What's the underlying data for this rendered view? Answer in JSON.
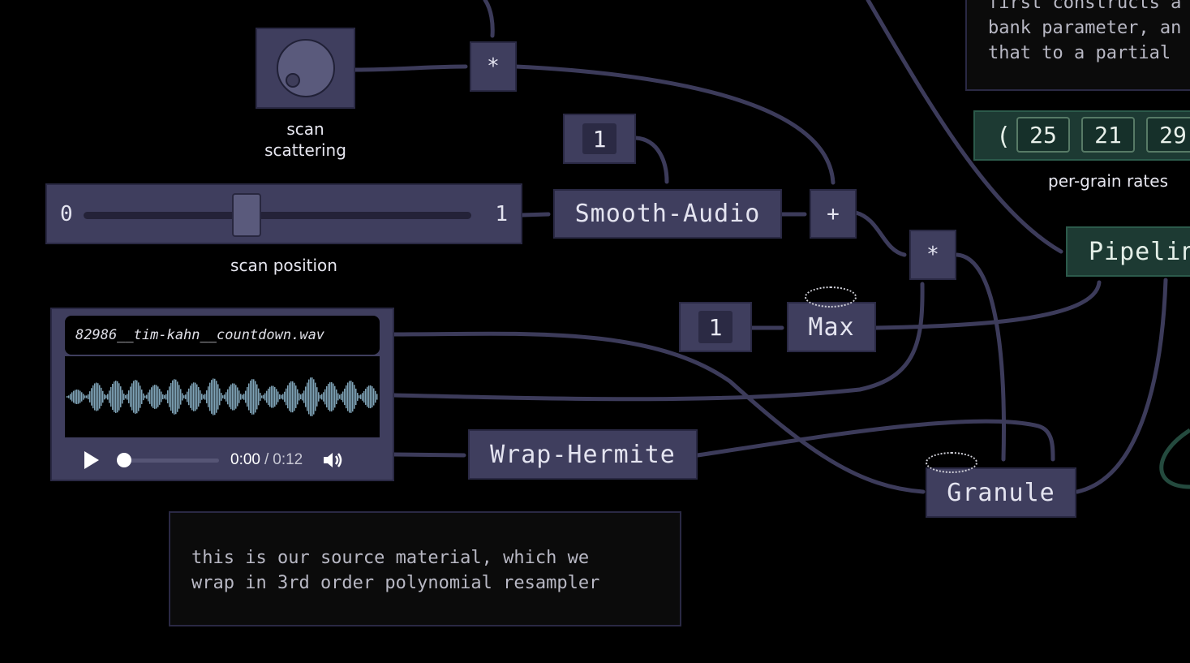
{
  "nodes": {
    "scan_scattering_knob": {
      "label": "scan\nscattering"
    },
    "multiply_top": {
      "symbol": "*"
    },
    "const_one_a": {
      "value": "1"
    },
    "smooth_audio": {
      "label": "Smooth-Audio"
    },
    "add": {
      "symbol": "+"
    },
    "multiply_mid": {
      "symbol": "*"
    },
    "scan_position_slider": {
      "min": "0",
      "max": "1",
      "value": 0.42,
      "label": "scan position"
    },
    "const_one_b": {
      "value": "1"
    },
    "max": {
      "label": "Max"
    },
    "wrap_hermite": {
      "label": "Wrap-Hermite"
    },
    "granule": {
      "label": "Granule"
    },
    "pipeline": {
      "label": "Pipelin"
    },
    "per_grain_rates": {
      "open_paren": "(",
      "values": [
        "25",
        "21",
        "29"
      ],
      "label": "per-grain rates"
    }
  },
  "audio_player": {
    "filename": "82986__tim-kahn__countdown.wav",
    "current_time": "0:00",
    "separator": "/",
    "duration": "0:12",
    "progress": 0
  },
  "comments": {
    "top_right": "first constructs a\nbank parameter, an\nthat to a partial",
    "source": "this is our source material, which we\nwrap in 3rd order polynomial resampler"
  },
  "colors": {
    "background": "#000000",
    "node": "#3f3e5e",
    "wire": "#3c3b58",
    "green_node": "#1d3a33",
    "green_border": "#577a66"
  }
}
